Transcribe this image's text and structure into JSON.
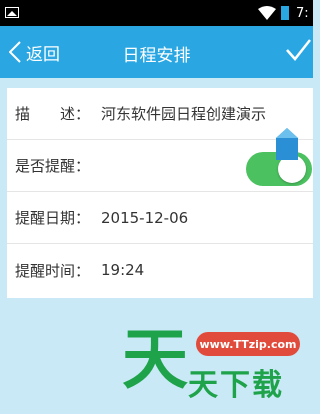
{
  "status_bar": {
    "time": "7:"
  },
  "nav": {
    "back_label": "返回",
    "title": "日程安排"
  },
  "form": {
    "description": {
      "label": "描　　述：",
      "value": "河东软件园日程创建演示"
    },
    "reminder": {
      "label": "是否提醒：",
      "enabled": true
    },
    "date": {
      "label": "提醒日期：",
      "value": "2015-12-06"
    },
    "time": {
      "label": "提醒时间：",
      "value": "19:24"
    }
  },
  "watermark": {
    "logo_char": "天",
    "url": "www.TTzip.com",
    "text": "天下载"
  },
  "colors": {
    "accent": "#2aa7e3",
    "toggle_on": "#4cc160",
    "background": "#c9e9f7"
  }
}
